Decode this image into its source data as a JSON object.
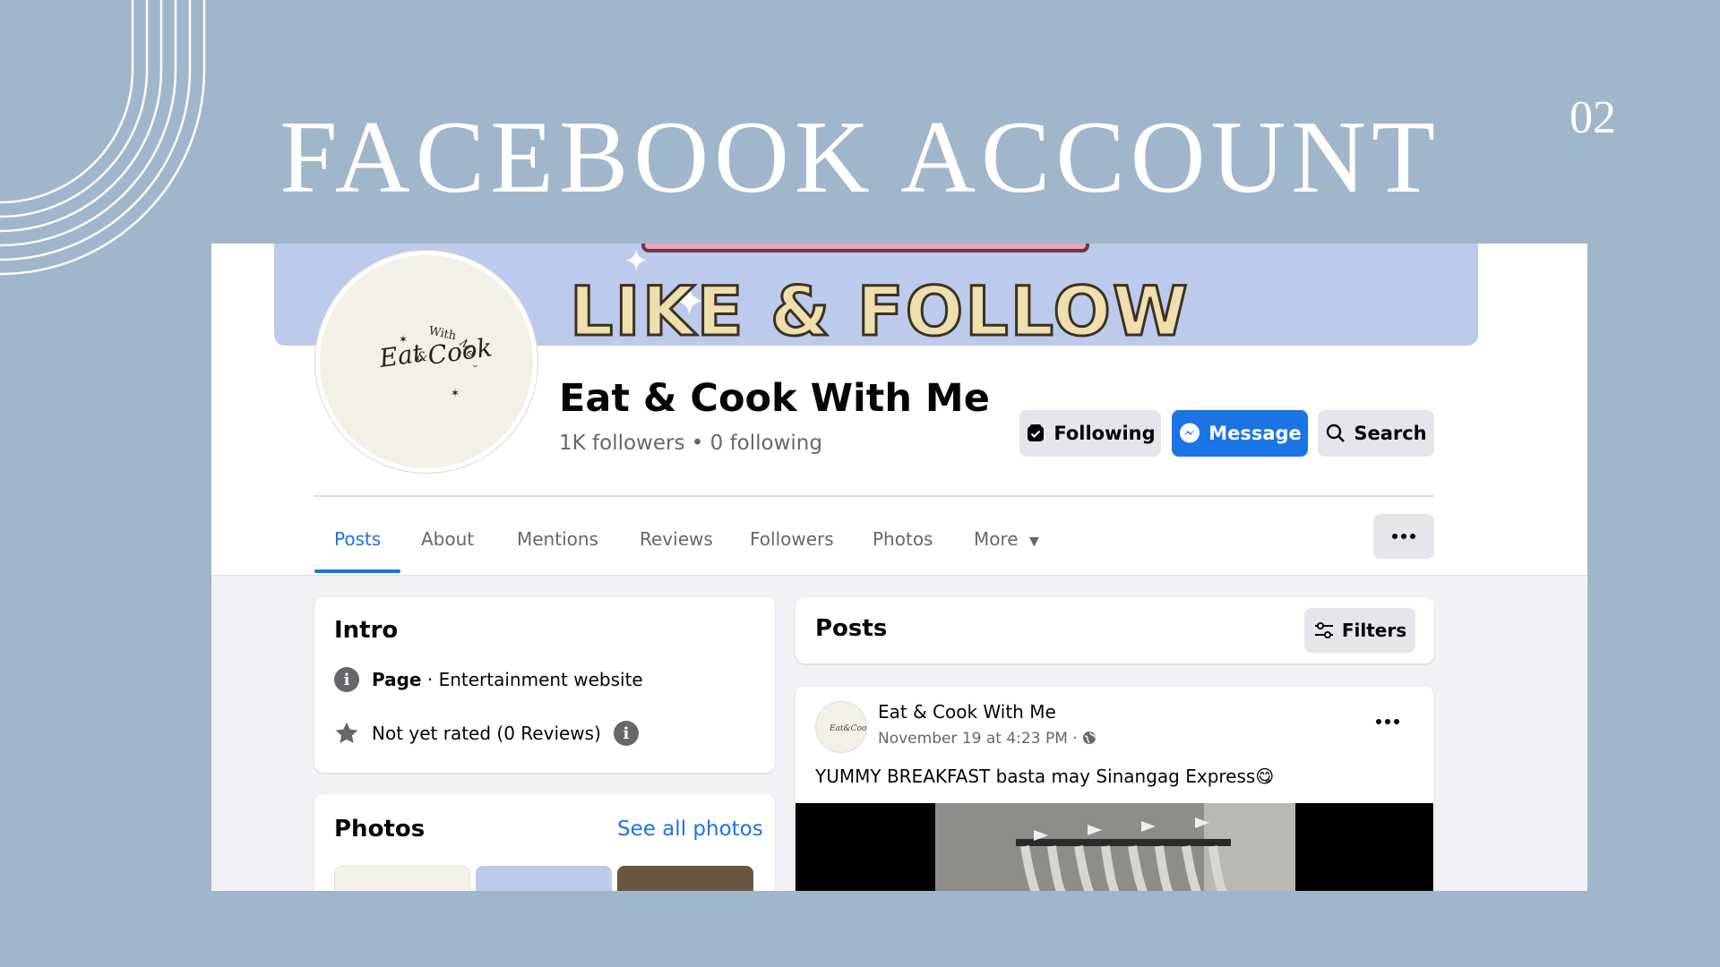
{
  "slide": {
    "title": "FACEBOOK ACCOUNT",
    "number": "02"
  },
  "profile": {
    "cover_text": "LIKE & FOLLOW",
    "avatar_logo": "Eat & Cook With Me",
    "name": "Eat & Cook With Me",
    "stats": "1K followers • 0 following"
  },
  "actions": {
    "following": "Following",
    "message": "Message",
    "search": "Search"
  },
  "tabs": [
    {
      "label": "Posts",
      "active": true
    },
    {
      "label": "About"
    },
    {
      "label": "Mentions"
    },
    {
      "label": "Reviews"
    },
    {
      "label": "Followers"
    },
    {
      "label": "Photos"
    },
    {
      "label": "More"
    }
  ],
  "intro": {
    "title": "Intro",
    "page_label": "Page",
    "page_category": " · Entertainment website",
    "rating": "Not yet rated (0 Reviews)"
  },
  "photos": {
    "title": "Photos",
    "see_all": "See all photos"
  },
  "posts_panel": {
    "title": "Posts",
    "filters": "Filters"
  },
  "post": {
    "author": "Eat & Cook With Me",
    "time": "November 19 at 4:23 PM · ",
    "text": "YUMMY BREAKFAST basta may Sinangag Express😋"
  },
  "colors": {
    "background": "#a0b6ca",
    "accent": "#1b74e4",
    "cover": "#bccbec"
  }
}
